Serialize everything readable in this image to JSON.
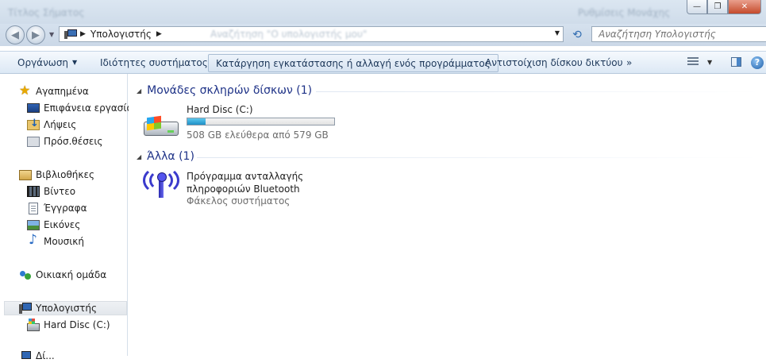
{
  "window": {
    "blurred_text_left": "Τίτλος Σήματος",
    "blurred_text_right": "Ρυθμίσεις Μονάχης",
    "minimize_glyph": "—",
    "maximize_glyph": "❐",
    "close_glyph": "✕"
  },
  "address_bar": {
    "back_glyph": "◀",
    "forward_glyph": "▶",
    "crumb_separator": "▶",
    "path": [
      "Υπολογιστής"
    ],
    "blurred_ghost_text": "Αναζήτηση \"Ο υπολογιστής μου\"",
    "dropdown_glyph": "▼",
    "refresh_glyph": "⟲"
  },
  "search": {
    "placeholder": "Αναζήτηση Υπολογιστής",
    "icon": "search-icon"
  },
  "toolbar": {
    "organize": "Οργάνωση",
    "dropdown_glyph": "▼",
    "system_properties": "Ιδιότητες συστήματος",
    "uninstall": "Κατάργηση εγκατάστασης ή αλλαγή ενός προγράμματος",
    "map_drive": "Αντιστοίχιση δίσκου δικτύου",
    "more": "»",
    "help_glyph": "?"
  },
  "nav": {
    "favorites": {
      "label": "Αγαπημένα",
      "items": [
        "Επιφάνεια εργασίας",
        "Λήψεις",
        "Πρόσ.θέσεις"
      ]
    },
    "libraries": {
      "label": "Βιβλιοθήκες",
      "items": [
        "Βίντεο",
        "Έγγραφα",
        "Εικόνες",
        "Μουσική"
      ]
    },
    "homegroup": "Οικιακή ομάδα",
    "computer": {
      "label": "Υπολογιστής",
      "items": [
        "Hard Disc (C:)"
      ]
    },
    "network_partial": "Δί..."
  },
  "content": {
    "groups": [
      {
        "title": "Μονάδες σκληρών δίσκων (1)",
        "collapse_glyph": "◢",
        "items": [
          {
            "name": "Hard Disc (C:)",
            "free_text": "508 GB ελεύθερα από 579 GB",
            "used_fraction": 0.123
          }
        ]
      },
      {
        "title": "Άλλα (1)",
        "collapse_glyph": "◢",
        "items": [
          {
            "name": "Πρόγραμμα ανταλλαγής πληροφοριών Bluetooth",
            "type": "Φάκελος συστήματος"
          }
        ]
      }
    ]
  },
  "colors": {
    "group_title": "#1e3287",
    "command_text": "#1e395b",
    "secondary_text": "#6d6d6d",
    "drive_fill": "#1e8fc7",
    "bluetooth": "#3a3acc"
  }
}
